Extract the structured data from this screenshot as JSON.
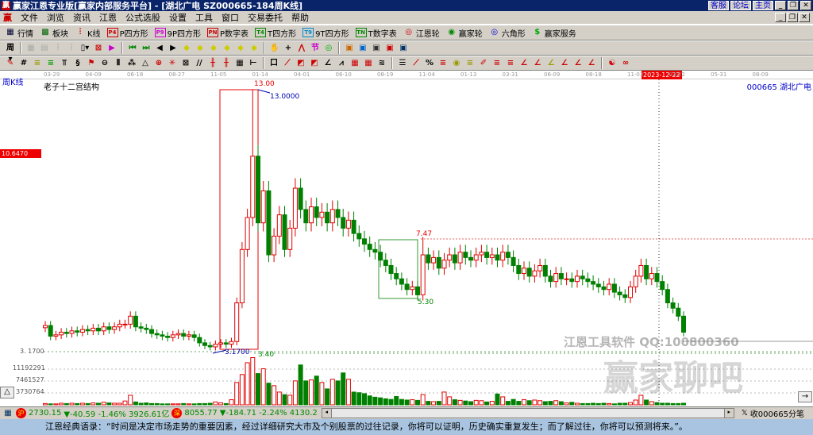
{
  "title": {
    "app": "赢家江恩专业版[赢家内部服务平台] - [湖北广电   SZ000665-184周K线]",
    "links": [
      "客服",
      "论坛",
      "主页"
    ]
  },
  "menu": [
    "文件",
    "浏览",
    "资讯",
    "江恩",
    "公式选股",
    "设置",
    "工具",
    "窗口",
    "交易委托",
    "帮助"
  ],
  "toolbar1": [
    {
      "icon": "quote-icon",
      "label": "行情",
      "color": "#003"
    },
    {
      "icon": "sector-icon",
      "label": "板块",
      "color": "#060"
    },
    {
      "icon": "kline-icon",
      "label": "K线",
      "color": "#c00"
    },
    {
      "icon": "P4",
      "label": "P四方形",
      "color": "#c00"
    },
    {
      "icon": "P9",
      "label": "9P四方形",
      "color": "#c0c"
    },
    {
      "icon": "PN",
      "label": "P数字表",
      "color": "#c00"
    },
    {
      "icon": "T4",
      "label": "T四方形",
      "color": "#080"
    },
    {
      "icon": "T9",
      "label": "9T四方形",
      "color": "#08c"
    },
    {
      "icon": "TN",
      "label": "T数字表",
      "color": "#080"
    },
    {
      "icon": "gann-wheel-icon",
      "label": "江恩轮",
      "color": "#c00"
    },
    {
      "icon": "winner-wheel-icon",
      "label": "赢家轮",
      "color": "#080"
    },
    {
      "icon": "hexagon-icon",
      "label": "六角形",
      "color": "#00c"
    },
    {
      "icon": "dollar-icon",
      "label": "赢家服务",
      "color": "#0a0"
    }
  ],
  "chart": {
    "period_label": "周K线",
    "indicator_title": "老子十二宫结构",
    "stock": "000665  湖北广电",
    "crosshair_price": "10.6470",
    "cursor_date": "2023-12-22",
    "label_high": "13.00",
    "label_high2": "13.0000",
    "label_low": "3.1700",
    "label_low_axis": "3. 1700",
    "label_340": "3.40",
    "label_747": "7.47",
    "label_530": "5.30",
    "watermark1": "江恩工具软件  QQ:100800360",
    "watermark2": "赢家聊吧",
    "dates": [
      "03-29",
      "04-09",
      "06-18",
      "08-27",
      "11-05",
      "01-14",
      "04-01",
      "06-10",
      "08-19",
      "11-04",
      "01-13",
      "03-31",
      "06-09",
      "08-18",
      "11-03",
      "03-22",
      "05-31",
      "08-09"
    ],
    "vol_ticks": [
      "11192291",
      "7461527",
      "3730764"
    ]
  },
  "chart_data": {
    "type": "candlestick",
    "price_range": [
      3.17,
      13.0
    ],
    "highlight_high": 13.0,
    "close": [
      4.15,
      3.75,
      3.8,
      3.9,
      3.85,
      3.95,
      3.9,
      4.0,
      3.95,
      4.05,
      3.95,
      4.1,
      4.0,
      4.1,
      4.2,
      4.2,
      4.5,
      4.1,
      4.05,
      4.0,
      3.85,
      3.8,
      3.75,
      3.7,
      3.8,
      3.85,
      3.75,
      3.8,
      3.7,
      3.5,
      3.4,
      3.35,
      3.45,
      3.5,
      3.45,
      3.55,
      5.0,
      7.0,
      8.2,
      10.5,
      8.0,
      9.2,
      6.8,
      7.5,
      8.3,
      7.0,
      7.8,
      9.3,
      8.5,
      8.0,
      8.6,
      8.2,
      8.4,
      8.0,
      8.5,
      8.2,
      7.8,
      8.1,
      7.6,
      7.4,
      7.2,
      7.0,
      6.9,
      6.6,
      6.4,
      6.1,
      5.9,
      5.7,
      5.5,
      5.6,
      5.3,
      6.8,
      6.5,
      6.7,
      6.3,
      6.6,
      6.8,
      6.5,
      6.9,
      6.7,
      6.6,
      6.8,
      6.9,
      6.7,
      6.8,
      6.6,
      6.9,
      6.7,
      6.4,
      6.1,
      6.3,
      6.0,
      6.2,
      6.4,
      6.0,
      5.8,
      6.1,
      5.9,
      5.9,
      5.8,
      6.0,
      5.9,
      5.8,
      5.7,
      5.6,
      5.5,
      5.7,
      5.4,
      5.3,
      5.2,
      5.6,
      6.0,
      6.4,
      5.9,
      6.1,
      5.8,
      5.5,
      5.0,
      4.8,
      4.5,
      3.9
    ],
    "volume_millions": [
      0.4,
      0.3,
      0.3,
      0.5,
      0.4,
      0.5,
      0.4,
      0.5,
      0.4,
      0.6,
      0.5,
      0.8,
      0.6,
      0.5,
      0.5,
      1.2,
      3.0,
      0.9,
      0.5,
      0.6,
      0.4,
      0.4,
      0.3,
      0.3,
      0.3,
      0.3,
      0.4,
      0.3,
      0.3,
      0.4,
      0.4,
      0.5,
      0.9,
      0.6,
      0.4,
      1.6,
      7.0,
      9.5,
      13.2,
      14.8,
      9.8,
      11.3,
      6.8,
      6.0,
      4.0,
      3.2,
      3.0,
      7.5,
      12.5,
      7.5,
      7.8,
      9.0,
      7.0,
      5.0,
      8.0,
      7.5,
      10.0,
      8.0,
      4.0,
      3.8,
      3.5,
      2.8,
      2.4,
      2.2,
      1.9,
      1.7,
      2.6,
      1.7,
      1.5,
      1.6,
      1.4,
      3.2,
      1.1,
      1.0,
      1.1,
      4.0,
      2.5,
      1.6,
      1.4,
      1.2,
      1.0,
      1.4,
      1.3,
      0.9,
      1.1,
      3.4,
      2.5,
      1.1,
      1.7,
      1.1,
      1.6,
      1.3,
      1.5,
      1.3,
      1.0,
      1.1,
      1.3,
      1.0,
      0.6,
      0.8,
      0.5,
      0.4,
      0.4,
      0.5,
      0.4,
      0.5,
      0.4,
      0.3,
      0.5,
      0.5,
      0.7,
      1.5,
      3.0,
      1.5,
      1.0,
      0.7,
      0.5,
      0.5,
      0.4,
      0.4,
      0.5
    ]
  },
  "status": {
    "sh_index": "2730.15",
    "sh_change": "▼-40.59 -1.46% 3926.61亿",
    "sz_index": "8055.77",
    "sz_change": "▼-184.71 -2.24% 4130.2",
    "sh_mark": "沪",
    "sz_mark": "深",
    "right": "收000665分笔"
  },
  "quote": "江恩经典语录：“时间是决定市场走势的重要因素，经过详细研究大市及个别股票的过往记录，你将可以证明，历史确实重复发生；而了解过往，你将可以预测将来。”。",
  "colors": {
    "up": "#e00000",
    "down": "#008000",
    "titlebar": "#0a246a"
  }
}
